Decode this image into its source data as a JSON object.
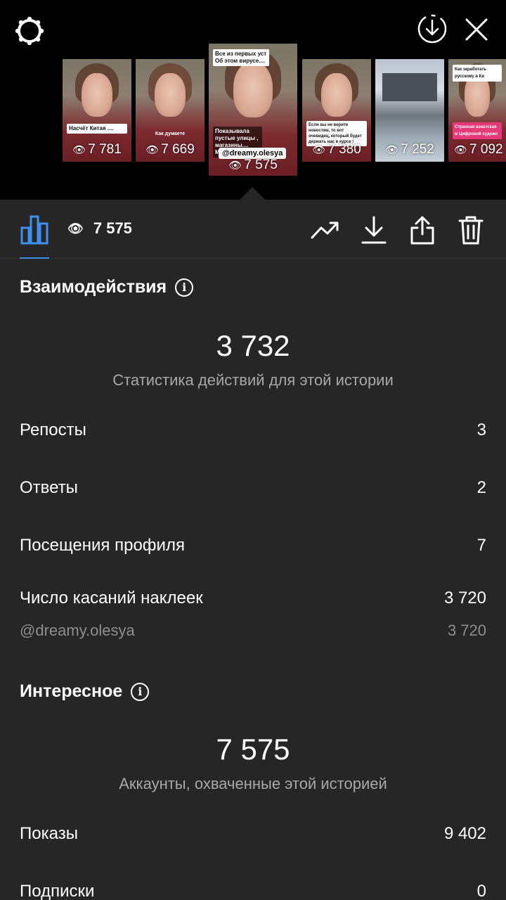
{
  "strip": {
    "thumbs": [
      {
        "caption": "Насчёт Китая ....",
        "views": "7 781"
      },
      {
        "caption": "Как думаете",
        "views": "7 669"
      },
      {
        "caption": "Все из первых уст Об этом вирусе....",
        "caption2": "Показывала пустые улицы , магазины.... Маски...",
        "tag": "@dreamy.olesya",
        "views": "7 575"
      },
      {
        "caption": "Если вы не верите новостям, то вот очевидец, который будет держать нас в курсе !",
        "views": "7 380"
      },
      {
        "views": "7 252"
      },
      {
        "caption": "Как заработать русскому в Ки",
        "caption2": "Странная азиатская м Цифровой художн",
        "views": "7 092"
      }
    ]
  },
  "toolbar": {
    "views": "7 575",
    "icons": [
      "bar-chart-icon",
      "eye-icon",
      "trending-icon",
      "download-icon",
      "share-icon",
      "trash-icon"
    ]
  },
  "interactions": {
    "title": "Взаимодействия",
    "total": "3 732",
    "subtitle": "Статистика действий для этой истории",
    "rows": [
      {
        "label": "Репосты",
        "value": "3"
      },
      {
        "label": "Ответы",
        "value": "2"
      },
      {
        "label": "Посещения профиля",
        "value": "7"
      },
      {
        "label": "Число касаний наклеек",
        "value": "3 720"
      }
    ],
    "sticker": {
      "label": "@dreamy.olesya",
      "value": "3 720"
    }
  },
  "discovery": {
    "title": "Интересное",
    "total": "7 575",
    "subtitle": "Аккаунты, охваченные этой историей",
    "rows": [
      {
        "label": "Показы",
        "value": "9 402"
      },
      {
        "label": "Подписки",
        "value": "0"
      }
    ]
  },
  "colors": {
    "accent": "#3d8ff0",
    "panel": "#262626",
    "top": "#000000"
  }
}
